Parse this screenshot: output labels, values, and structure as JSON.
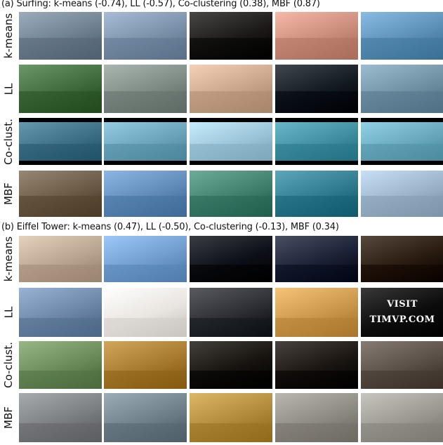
{
  "section_a_title": "(a) Surfing: k-means (-0.74),  LL (-0.57), Co-clustering (0.38), MBF (0.87)",
  "section_b_title": "(b) Eiffel Tower: k-means (0.47),  LL (-0.50), Co-clustering (-0.13), MBF (0.34)",
  "row_labels": [
    "k-means",
    "LL",
    "Co-clust.",
    "MBF"
  ],
  "visit_overlay": {
    "line1": "VISIT",
    "line2": "TIMVP.COM"
  },
  "thumb_colors": {
    "a": [
      [
        "#6e7f8f",
        "#7a8fa8",
        "#1b1a18",
        "#c98c7a",
        "#5b8fb5"
      ],
      [
        "#3f6a3c",
        "#7d8a84",
        "#c7a48a",
        "#131a22",
        "#6f8fa3"
      ],
      [
        "#3d6f86",
        "#6aa3ba",
        "#9cc4d8",
        "#3f8fa0",
        "#69a8bd"
      ],
      [
        "#6b5a45",
        "#5f8ab8",
        "#3f7f6c",
        "#2f7a8c",
        "#9bb3c8"
      ]
    ],
    "b": [
      [
        "#b9a48f",
        "#6f9ccc",
        "#0e1018",
        "#1c2235",
        "#2a1c10"
      ],
      [
        "#6b86a6",
        "#e9e5e0",
        "#2c2e33",
        "#c9974c",
        "#0c0c0c"
      ],
      [
        "#6a8a5a",
        "#a57a2e",
        "#17130f",
        "#1b1612",
        "#5a4f47"
      ],
      [
        "#7b7e80",
        "#6f7f8a",
        "#b08a3a",
        "#8d8a82",
        "#9a9890"
      ]
    ]
  }
}
